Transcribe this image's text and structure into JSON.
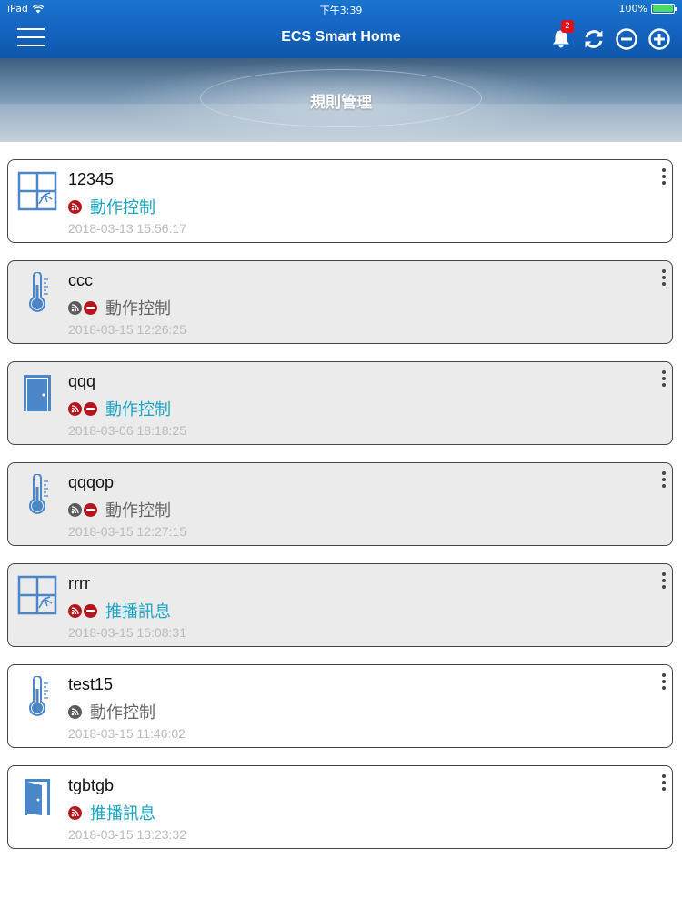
{
  "status_bar": {
    "device": "iPad",
    "time": "下午3:39",
    "battery": "100%",
    "battery_level": 1.0
  },
  "nav": {
    "title": "ECS Smart Home",
    "notification_count": "2",
    "icons": [
      "menu-icon",
      "bell-icon",
      "refresh-icon",
      "minus-circle-icon",
      "plus-circle-icon"
    ]
  },
  "banner": {
    "title": "規則管理"
  },
  "colors": {
    "nav_blue": "#1566c2",
    "action_teal": "#1aa6c4",
    "disabled_red": "#b3161c",
    "card_disabled_bg": "#ebebeb"
  },
  "rules": [
    {
      "name": "12345",
      "device": "window",
      "enabled": true,
      "stopped": false,
      "action": "動作控制",
      "time": "2018-03-13 15:56:17"
    },
    {
      "name": "ccc",
      "device": "thermometer",
      "enabled": false,
      "stopped": true,
      "action": "動作控制",
      "time": "2018-03-15 12:26:25"
    },
    {
      "name": "qqq",
      "device": "door",
      "enabled": true,
      "stopped": true,
      "action": "動作控制",
      "time": "2018-03-06 18:18:25"
    },
    {
      "name": "qqqop",
      "device": "thermometer",
      "enabled": false,
      "stopped": true,
      "action": "動作控制",
      "time": "2018-03-15 12:27:15"
    },
    {
      "name": "rrrr",
      "device": "window",
      "enabled": true,
      "stopped": true,
      "action": "推播訊息",
      "time": "2018-03-15 15:08:31"
    },
    {
      "name": "test15",
      "device": "thermometer",
      "enabled": false,
      "stopped": false,
      "action": "動作控制",
      "time": "2018-03-15 11:46:02"
    },
    {
      "name": "tgbtgb",
      "device": "door-open",
      "enabled": true,
      "stopped": false,
      "action": "推播訊息",
      "time": "2018-03-15 13:23:32"
    }
  ]
}
